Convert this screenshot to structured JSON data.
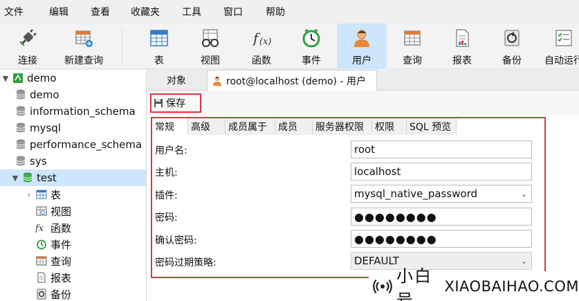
{
  "menu": [
    "文件",
    "编辑",
    "查看",
    "收藏夹",
    "工具",
    "窗口",
    "帮助"
  ],
  "toolbar": [
    {
      "label": "连接",
      "icon": "connect-plug-icon"
    },
    {
      "label": "新建查询",
      "icon": "new-query-icon"
    },
    {
      "label": "表",
      "icon": "table-icon"
    },
    {
      "label": "视图",
      "icon": "view-glasses-icon"
    },
    {
      "label": "函数",
      "icon": "function-fx-icon"
    },
    {
      "label": "事件",
      "icon": "event-clock-icon"
    },
    {
      "label": "用户",
      "icon": "user-icon"
    },
    {
      "label": "查询",
      "icon": "query-icon"
    },
    {
      "label": "报表",
      "icon": "report-icon"
    },
    {
      "label": "备份",
      "icon": "backup-icon"
    },
    {
      "label": "自动运行",
      "icon": "auto-run-icon"
    }
  ],
  "tree": {
    "connection": "demo",
    "databases": [
      "demo",
      "information_schema",
      "mysql",
      "performance_schema",
      "sys",
      "test"
    ],
    "test_children": [
      "表",
      "视图",
      "函数",
      "事件",
      "查询",
      "报表",
      "备份"
    ]
  },
  "tabs": {
    "objects": "对象",
    "user_tab": "root@localhost (demo) - 用户"
  },
  "save_label": "保存",
  "subtabs": [
    "常规",
    "高级",
    "成员属于",
    "成员",
    "服务器权限",
    "权限",
    "SQL 预览"
  ],
  "form": {
    "username_label": "用户名:",
    "username": "root",
    "host_label": "主机:",
    "host": "localhost",
    "plugin_label": "插件:",
    "plugin": "mysql_native_password",
    "password_label": "密码:",
    "password": "●●●●●●●●",
    "confirm_label": "确认密码:",
    "confirm": "●●●●●●●●",
    "expire_label": "密码过期策略:",
    "expire": "DEFAULT"
  },
  "watermark": {
    "cn": "小白号",
    "en": "XIAOBAIHAO.COM"
  },
  "colors": {
    "highlight": "#d9363e",
    "selected": "#cde6fb",
    "db_green": "#2e9e3e"
  }
}
